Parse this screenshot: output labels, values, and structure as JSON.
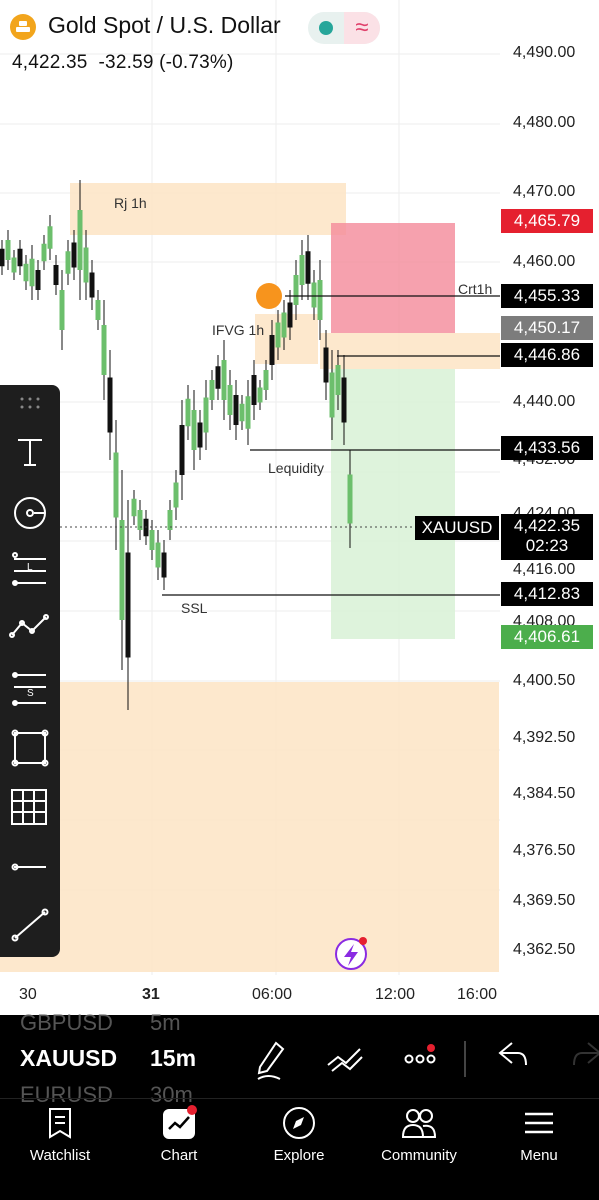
{
  "header": {
    "title": "Gold Spot / U.S. Dollar",
    "price": "4,422.35",
    "change": "-32.59",
    "change_pct": "(-0.73%)",
    "toggle_icon": "≈"
  },
  "colors": {
    "up": "#6cbf6c",
    "down": "#111111",
    "zone_orange": "#fde4c4",
    "zone_red": "#f48a9a",
    "zone_green": "#d8f1d6",
    "label_red": "#e5202f",
    "label_gray": "#7c7c7c",
    "label_green": "#4cae4c",
    "marker": "#f7941d"
  },
  "price_axis": {
    "ticks": [
      "4,490.00",
      "4,480.00",
      "4,470.00",
      "4,460.00",
      "4,440.00",
      "4,432.00",
      "4,424.00",
      "4,416.00",
      "4,408.00",
      "4,400.50",
      "4,392.50",
      "4,384.50",
      "4,376.50",
      "4,369.50",
      "4,362.50"
    ],
    "labels": {
      "red": "4,465.79",
      "l1": "4,455.33",
      "gray": "4,450.17",
      "l2": "4,446.86",
      "l3": "4,433.56",
      "current_symbol": "XAUUSD",
      "current": "4,422.35",
      "countdown": "02:23",
      "l4": "4,412.83",
      "green": "4,406.61"
    }
  },
  "time_axis": [
    "30",
    "31",
    "06:00",
    "12:00",
    "16:00"
  ],
  "annotations": {
    "rj": "Rj 1h",
    "ifvg": "IFVG 1h",
    "crt": "Crt1h",
    "liquidity": "Lequidity",
    "ssl": "SSL"
  },
  "tools": [
    "text-tool-icon",
    "circle-tool-icon",
    "long-position-tool-icon",
    "trend-tool-icon",
    "short-position-tool-icon",
    "rectangle-tool-icon",
    "grid-tool-icon",
    "horizontal-line-tool-icon",
    "line-tool-icon"
  ],
  "bottom_bar": {
    "prev_symbol": "GBPUSD",
    "prev_interval": "5m",
    "symbol": "XAUUSD",
    "interval": "15m",
    "next_symbol": "EURUSD",
    "next_interval": "30m"
  },
  "nav": [
    "Watchlist",
    "Chart",
    "Explore",
    "Community",
    "Menu"
  ]
}
